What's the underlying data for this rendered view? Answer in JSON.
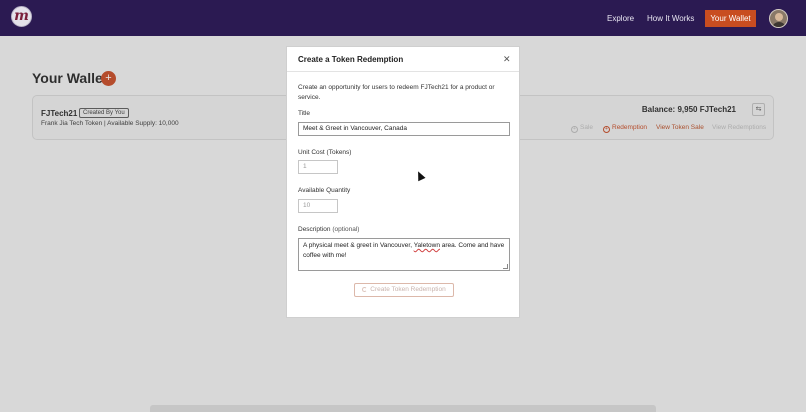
{
  "nav": {
    "logo_letter": "m",
    "explore": "Explore",
    "how_it_works": "How It Works",
    "cta": "Your Wallet"
  },
  "wallet": {
    "title": "Your Wallet",
    "add_icon": "plus-icon",
    "token": {
      "symbol": "FJTech21",
      "badge": "Created By You",
      "description": "Frank Jia Tech Token | Available Supply: 10,000",
      "balance": "Balance: 9,950 FJTech21"
    },
    "actions": {
      "sale": "Sale",
      "redemption": "Redemption",
      "view_sale": "View Token Sale",
      "view_redemptions": "View Redemptions"
    }
  },
  "modal": {
    "title": "Create a Token Redemption",
    "intro": "Create an opportunity for users to redeem FJTech21 for a product or service.",
    "title_label": "Title",
    "title_value": "Meet & Greet in Vancouver, Canada",
    "unit_cost_label": "Unit Cost (Tokens)",
    "unit_cost_placeholder": "1",
    "quantity_label": "Available Quantity",
    "quantity_placeholder": "10",
    "description_label": "Description",
    "description_optional": "(optional)",
    "description_value_a": "A physical meet & greet in Vancouver, ",
    "description_value_b": "Yaletown",
    "description_value_c": " area. Come and have coffee with me!",
    "submit": "Create Token Redemption"
  },
  "colors": {
    "nav_bg": "#2b1a52",
    "accent": "#c84d20"
  }
}
